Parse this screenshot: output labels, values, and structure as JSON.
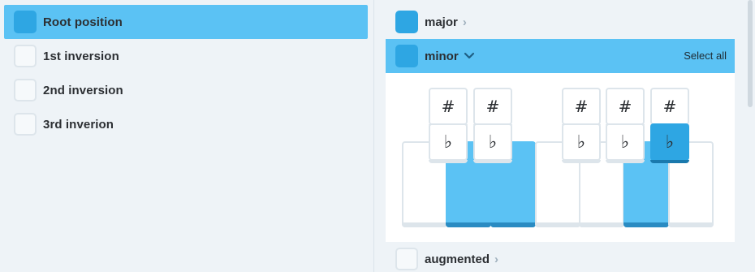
{
  "inversions": [
    {
      "label": "Root position",
      "checked": true
    },
    {
      "label": "1st inversion",
      "checked": false
    },
    {
      "label": "2nd inversion",
      "checked": false
    },
    {
      "label": "3rd inverion",
      "checked": false
    }
  ],
  "qualities": {
    "major": {
      "label": "major",
      "checked": true,
      "chevron": "chevron-right-icon"
    },
    "minor": {
      "label": "minor",
      "checked": true,
      "chevron": "chevron-down-icon",
      "select_all": "Select all"
    },
    "augmented": {
      "label": "augmented",
      "checked": false,
      "chevron": "chevron-right-icon"
    }
  },
  "keyboard": {
    "sharp_symbol": "#",
    "flat_symbol": "♭",
    "highlighted_white_keys": [
      2,
      3,
      7
    ],
    "selected_flat": 5
  },
  "colors": {
    "accent": "#5bc2f4",
    "accent_dark": "#2ea6e3",
    "background": "#eef3f7"
  }
}
